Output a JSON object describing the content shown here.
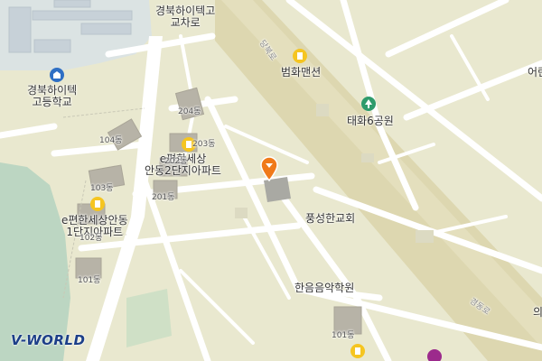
{
  "map": {
    "labels": {
      "crossroad": "경북하이텍고\n교차로",
      "school": "경북하이텍\n고등학교",
      "beomhwa": "범화맨션",
      "park": "태화6공원",
      "apt2": "e편한세상\n안동2단지아파트",
      "apt1": "e편한세상안동\n1단지아파트",
      "church": "풍성한교회",
      "music": "한음음악학원",
      "right_edge": "어린",
      "right_edge2": "의",
      "road_dang": "당북로",
      "road_gyeongdong": "경동로",
      "b104": "104동",
      "b103": "103동",
      "b102": "102동",
      "b101": "101동",
      "b204": "204동",
      "b203": "203동",
      "b202": "202동",
      "b201": "201동",
      "b101b": "101동"
    },
    "icons": {
      "school_icon": "school-icon",
      "apartment_icon": "apartment-icon",
      "park_icon": "park-icon",
      "marker_icon": "location-pin-icon"
    },
    "colors": {
      "land": "#e9e8cf",
      "road": "#ffffff",
      "main_road": "#ddd7b0",
      "school_area": "#dfe7ec",
      "park_green": "#2e9b6b",
      "poi_yellow": "#f5c521",
      "marker_orange": "#f07a1a",
      "water": "#a9c6e3"
    },
    "logo": "V-WORLD"
  }
}
